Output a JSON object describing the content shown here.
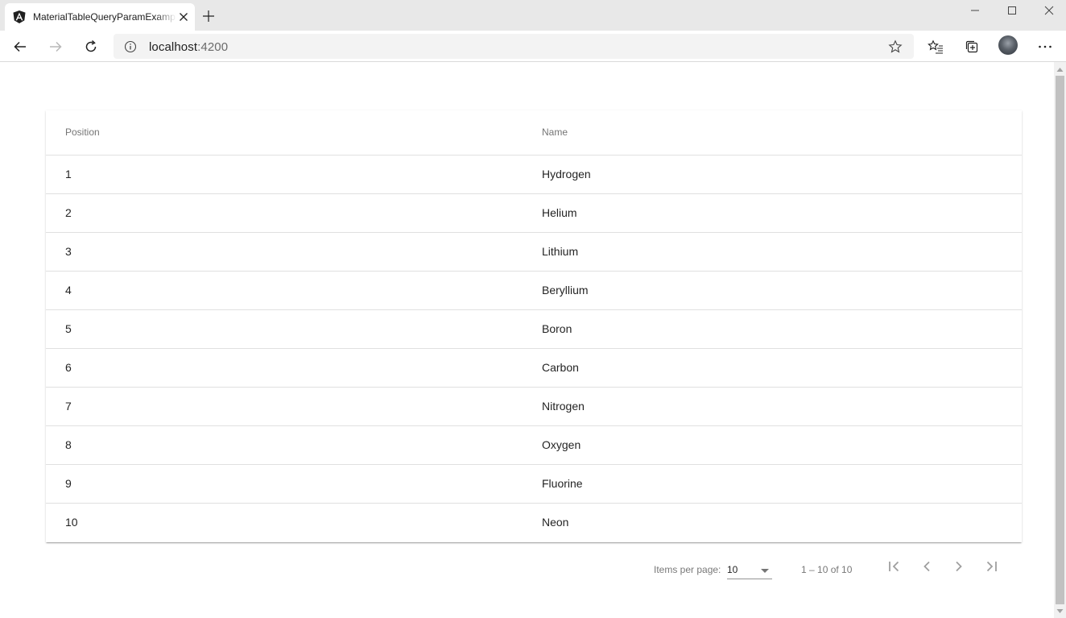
{
  "browser": {
    "tab_title": "MaterialTableQueryParamExample",
    "address": {
      "host": "localhost",
      "port": ":4200"
    }
  },
  "table": {
    "headers": {
      "position": "Position",
      "name": "Name"
    },
    "rows": [
      {
        "position": "1",
        "name": "Hydrogen"
      },
      {
        "position": "2",
        "name": "Helium"
      },
      {
        "position": "3",
        "name": "Lithium"
      },
      {
        "position": "4",
        "name": "Beryllium"
      },
      {
        "position": "5",
        "name": "Boron"
      },
      {
        "position": "6",
        "name": "Carbon"
      },
      {
        "position": "7",
        "name": "Nitrogen"
      },
      {
        "position": "8",
        "name": "Oxygen"
      },
      {
        "position": "9",
        "name": "Fluorine"
      },
      {
        "position": "10",
        "name": "Neon"
      }
    ]
  },
  "paginator": {
    "items_per_page_label": "Items per page:",
    "page_size": "10",
    "range_label": "1 – 10 of 10"
  }
}
